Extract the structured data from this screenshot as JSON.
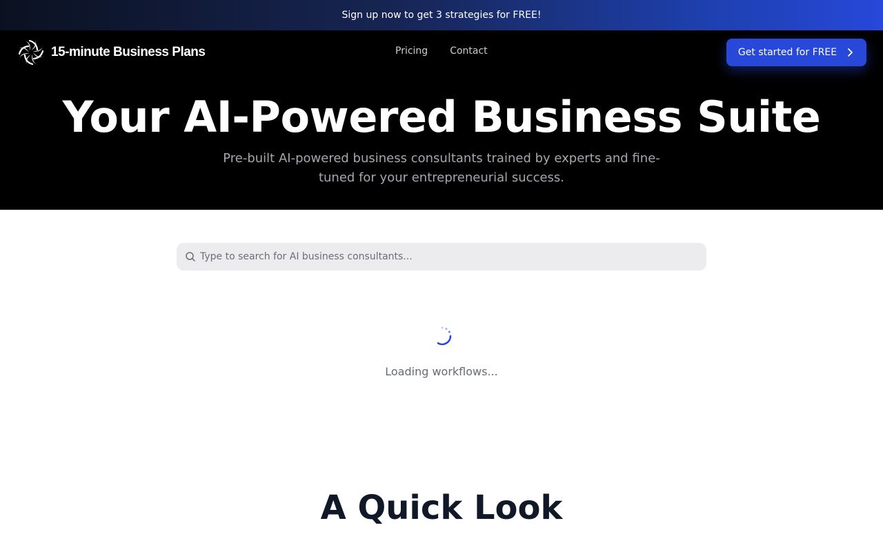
{
  "promo": {
    "text": "Sign up now to get 3 strategies for FREE!"
  },
  "header": {
    "logo_text": "15-minute Business Plans",
    "logo_icon": "swirl-logo-icon",
    "nav": [
      {
        "label": "Pricing"
      },
      {
        "label": "Contact"
      }
    ],
    "cta_label": "Get started for FREE",
    "cta_icon": "chevron-right-icon"
  },
  "hero": {
    "title": "Your AI-Powered Business Suite",
    "subtitle": "Pre-built AI-powered business consultants trained by experts and fine-tuned for your entrepreneurial success."
  },
  "search": {
    "icon": "search-icon",
    "placeholder": "Type to search for AI business consultants...",
    "value": ""
  },
  "loading": {
    "icon": "spinner-icon",
    "text": "Loading workflows..."
  },
  "section": {
    "title": "A Quick Look"
  },
  "colors": {
    "accent": "#2748d9",
    "hero_bg": "#000000",
    "search_bg": "#ececee"
  }
}
